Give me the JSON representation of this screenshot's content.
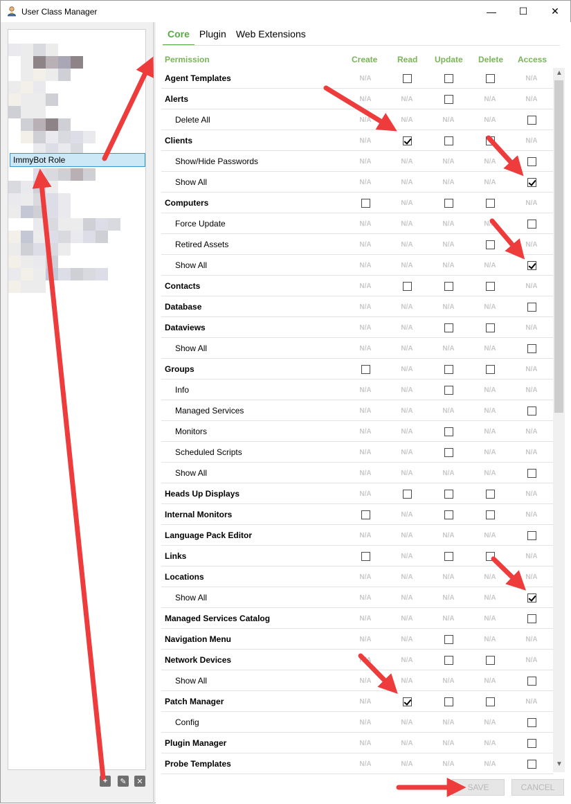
{
  "window": {
    "title": "User Class Manager",
    "minimize": "—",
    "maximize": "☐",
    "close": "✕"
  },
  "left_panel": {
    "selected_role": "ImmyBot Role",
    "actions": {
      "add": "+",
      "edit": "✎",
      "delete": "✕"
    }
  },
  "tabs": [
    {
      "label": "Core",
      "active": true
    },
    {
      "label": "Plugin",
      "active": false
    },
    {
      "label": "Web Extensions",
      "active": false
    }
  ],
  "columns": [
    "Permission",
    "Create",
    "Read",
    "Update",
    "Delete",
    "Access"
  ],
  "na_label": "N/A",
  "rows": [
    {
      "name": "Agent Templates",
      "level": 0,
      "cells": [
        "na",
        "box",
        "box",
        "box",
        "na"
      ]
    },
    {
      "name": "Alerts",
      "level": 0,
      "cells": [
        "na",
        "na",
        "box",
        "na",
        "na"
      ]
    },
    {
      "name": "Delete All",
      "level": 1,
      "cells": [
        "na",
        "na",
        "na",
        "na",
        "box"
      ]
    },
    {
      "name": "Clients",
      "level": 0,
      "cells": [
        "na",
        "checked",
        "box",
        "box",
        "na"
      ]
    },
    {
      "name": "Show/Hide Passwords",
      "level": 1,
      "cells": [
        "na",
        "na",
        "na",
        "na",
        "box"
      ]
    },
    {
      "name": "Show All",
      "level": 1,
      "cells": [
        "na",
        "na",
        "na",
        "na",
        "checked"
      ]
    },
    {
      "name": "Computers",
      "level": 0,
      "cells": [
        "box",
        "na",
        "box",
        "box",
        "na"
      ]
    },
    {
      "name": "Force Update",
      "level": 1,
      "cells": [
        "na",
        "na",
        "na",
        "na",
        "box"
      ]
    },
    {
      "name": "Retired Assets",
      "level": 1,
      "cells": [
        "na",
        "na",
        "na",
        "box",
        "na"
      ]
    },
    {
      "name": "Show All",
      "level": 1,
      "cells": [
        "na",
        "na",
        "na",
        "na",
        "checked"
      ]
    },
    {
      "name": "Contacts",
      "level": 0,
      "cells": [
        "na",
        "box",
        "box",
        "box",
        "na"
      ]
    },
    {
      "name": "Database",
      "level": 0,
      "cells": [
        "na",
        "na",
        "na",
        "na",
        "box"
      ]
    },
    {
      "name": "Dataviews",
      "level": 0,
      "cells": [
        "na",
        "na",
        "box",
        "box",
        "na"
      ]
    },
    {
      "name": "Show All",
      "level": 1,
      "cells": [
        "na",
        "na",
        "na",
        "na",
        "box"
      ]
    },
    {
      "name": "Groups",
      "level": 0,
      "cells": [
        "box",
        "na",
        "box",
        "box",
        "na"
      ]
    },
    {
      "name": "Info",
      "level": 1,
      "cells": [
        "na",
        "na",
        "box",
        "na",
        "na"
      ]
    },
    {
      "name": "Managed Services",
      "level": 1,
      "cells": [
        "na",
        "na",
        "na",
        "na",
        "box"
      ]
    },
    {
      "name": "Monitors",
      "level": 1,
      "cells": [
        "na",
        "na",
        "box",
        "na",
        "na"
      ]
    },
    {
      "name": "Scheduled Scripts",
      "level": 1,
      "cells": [
        "na",
        "na",
        "box",
        "na",
        "na"
      ]
    },
    {
      "name": "Show All",
      "level": 1,
      "cells": [
        "na",
        "na",
        "na",
        "na",
        "box"
      ]
    },
    {
      "name": "Heads Up Displays",
      "level": 0,
      "cells": [
        "na",
        "box",
        "box",
        "box",
        "na"
      ]
    },
    {
      "name": "Internal Monitors",
      "level": 0,
      "cells": [
        "box",
        "na",
        "box",
        "box",
        "na"
      ]
    },
    {
      "name": "Language Pack Editor",
      "level": 0,
      "cells": [
        "na",
        "na",
        "na",
        "na",
        "box"
      ]
    },
    {
      "name": "Links",
      "level": 0,
      "cells": [
        "box",
        "na",
        "box",
        "box",
        "na"
      ]
    },
    {
      "name": "Locations",
      "level": 0,
      "cells": [
        "na",
        "na",
        "na",
        "na",
        "na"
      ]
    },
    {
      "name": "Show All",
      "level": 1,
      "cells": [
        "na",
        "na",
        "na",
        "na",
        "checked"
      ]
    },
    {
      "name": "Managed Services Catalog",
      "level": 0,
      "cells": [
        "na",
        "na",
        "na",
        "na",
        "box"
      ]
    },
    {
      "name": "Navigation Menu",
      "level": 0,
      "cells": [
        "na",
        "na",
        "box",
        "na",
        "na"
      ]
    },
    {
      "name": "Network Devices",
      "level": 0,
      "cells": [
        "na",
        "na",
        "box",
        "box",
        "na"
      ]
    },
    {
      "name": "Show All",
      "level": 1,
      "cells": [
        "na",
        "na",
        "na",
        "na",
        "box"
      ]
    },
    {
      "name": "Patch Manager",
      "level": 0,
      "cells": [
        "na",
        "checked",
        "box",
        "box",
        "na"
      ]
    },
    {
      "name": "Config",
      "level": 1,
      "cells": [
        "na",
        "na",
        "na",
        "na",
        "box"
      ]
    },
    {
      "name": "Plugin Manager",
      "level": 0,
      "cells": [
        "na",
        "na",
        "na",
        "na",
        "box"
      ]
    },
    {
      "name": "Probe Templates",
      "level": 0,
      "cells": [
        "na",
        "na",
        "na",
        "na",
        "box"
      ]
    }
  ],
  "footer": {
    "save": "SAVE",
    "cancel": "CANCEL"
  },
  "colors": {
    "accent_green": "#5aaa46",
    "selection": "#cce8f6",
    "arrow_red": "#ee3b3b"
  }
}
